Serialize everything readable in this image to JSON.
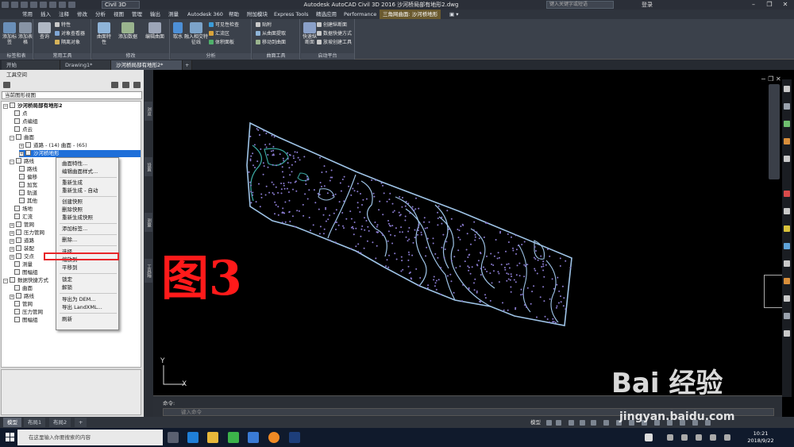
{
  "window": {
    "workspace": "Civil 3D",
    "title": "Autodesk AutoCAD Civil 3D 2016   沙河桥局部有地形2.dwg",
    "search_placeholder": "键入关键字或短语",
    "login": "登录"
  },
  "menu_tabs": [
    "常用",
    "插入",
    "注释",
    "修改",
    "分析",
    "视图",
    "管理",
    "输出",
    "测量",
    "Autodesk 360",
    "帮助",
    "附加模块",
    "Express Tools",
    "精选应用",
    "Performance",
    "三角网曲面: 沙河桥地形"
  ],
  "ribbon": {
    "groups": [
      {
        "label": "标签和表",
        "buttons": [
          "添加标签",
          "添加表格"
        ]
      },
      {
        "label": "常用工具",
        "buttons": [
          "查询",
          "特性",
          "对象查看器",
          "隔离对象"
        ]
      },
      {
        "label": "修改",
        "buttons": [
          "曲面特性",
          "添加数据",
          "编辑曲面"
        ]
      },
      {
        "label": "分析",
        "buttons": [
          "取水",
          "融入相交特征线",
          "可见性检查",
          "汇流区",
          "体积面板"
        ]
      },
      {
        "label": "曲面工具",
        "buttons": [
          "贴附",
          "从曲面提取",
          "移动到曲面"
        ]
      },
      {
        "label": "启动平台",
        "buttons": [
          "快速纵断面",
          "创建纵断面",
          "数据快捷方式",
          "放坡创建工具"
        ]
      }
    ]
  },
  "doc_tabs": [
    "开始",
    "Drawing1*",
    "沙河桥局部有地形2*"
  ],
  "toolspace": {
    "title": "工具空间",
    "view": "当前图形视图",
    "tree": [
      "沙河桥局部有地形2",
      "点",
      "点编组",
      "点云",
      "曲面",
      "道路 - (14) 曲面 - (65)",
      "沙河桥地形",
      "路线",
      "路线",
      "偏移",
      "加宽",
      "轨道",
      "其他",
      "场地",
      "汇流",
      "管网",
      "压力管网",
      "道路",
      "装配",
      "交点",
      "测量",
      "图幅组",
      "数据快捷方式",
      "曲面",
      "路线",
      "管网",
      "压力管网",
      "图幅组"
    ],
    "side_tabs": [
      "浏览",
      "设置",
      "测量",
      "工具箱"
    ]
  },
  "context_menu": {
    "items": [
      "曲面特性...",
      "编辑曲面样式...",
      "重新生成",
      "重新生成 - 自动",
      "创建快照",
      "删除快照",
      "重新生成快照",
      "添加标签...",
      "删除...",
      "选择",
      "缩放到",
      "平移到",
      "锁定",
      "解锁",
      "导出为 DEM...",
      "导出 LandXML...",
      "刷新"
    ],
    "highlighted": "选择"
  },
  "figure_label": "图3",
  "ucs": {
    "y": "Y",
    "x": "X"
  },
  "command": {
    "history": "命令:",
    "placeholder": "键入命令"
  },
  "layout_tabs": [
    "模型",
    "布局1",
    "布局2",
    "+"
  ],
  "status": {
    "mode": "模型"
  },
  "taskbar": {
    "search": "在这里输入你要搜索的内容",
    "time": "10:21",
    "date": "2018/9/22"
  },
  "watermark": {
    "logo": "Bai 经验",
    "url": "jingyan.baidu.com"
  },
  "colors": {
    "surface_outline": "#9ec3e6",
    "surface_points": "#8a7bd0",
    "contour_teal": "#3aa6a0",
    "highlight_red": "#e8262a",
    "label_red": "#ff1a1a",
    "selected_blue": "#1e6fd9"
  }
}
